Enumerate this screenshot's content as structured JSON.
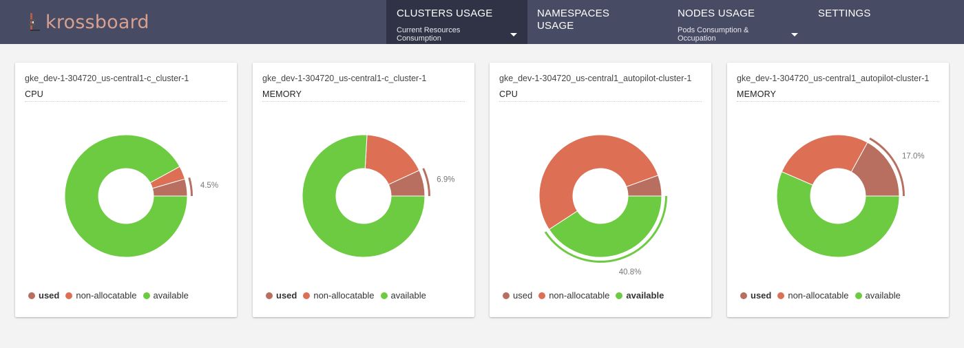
{
  "app": {
    "logo_text": "krossboard"
  },
  "nav": [
    {
      "label": "CLUSTERS USAGE",
      "sub": "Current Resources Consumption",
      "active": true
    },
    {
      "label": "NAMESPACES USAGE",
      "sub": "",
      "active": false
    },
    {
      "label": "NODES USAGE",
      "sub": "Pods Consumption & Occupation",
      "active": false
    },
    {
      "label": "SETTINGS",
      "sub": "",
      "active": false
    }
  ],
  "colors": {
    "used": "#b86f60",
    "non_allocatable": "#dd6f55",
    "available": "#6dcb42",
    "header_bg": "#474b63",
    "header_active_bg": "#2f3345"
  },
  "legend": {
    "used": "used",
    "non_allocatable": "non-allocatable",
    "available": "available"
  },
  "cards": [
    {
      "cluster": "gke_dev-1-304720_us-central1-c_cluster-1",
      "metric": "CPU",
      "highlight": "used",
      "highlight_label": "4.5%"
    },
    {
      "cluster": "gke_dev-1-304720_us-central1-c_cluster-1",
      "metric": "MEMORY",
      "highlight": "used",
      "highlight_label": "6.9%"
    },
    {
      "cluster": "gke_dev-1-304720_us-central1_autopilot-cluster-1",
      "metric": "CPU",
      "highlight": "available",
      "highlight_label": "40.8%"
    },
    {
      "cluster": "gke_dev-1-304720_us-central1_autopilot-cluster-1",
      "metric": "MEMORY",
      "highlight": "used",
      "highlight_label": "17.0%"
    }
  ],
  "chart_data": [
    {
      "type": "pie",
      "title": "CPU",
      "categories": [
        "used",
        "non-allocatable",
        "available"
      ],
      "values": [
        4.5,
        3.5,
        92.0
      ]
    },
    {
      "type": "pie",
      "title": "MEMORY",
      "categories": [
        "used",
        "non-allocatable",
        "available"
      ],
      "values": [
        6.9,
        17.2,
        75.9
      ]
    },
    {
      "type": "pie",
      "title": "CPU",
      "categories": [
        "used",
        "non-allocatable",
        "available"
      ],
      "values": [
        5.5,
        53.7,
        40.8
      ]
    },
    {
      "type": "pie",
      "title": "MEMORY",
      "categories": [
        "used",
        "non-allocatable",
        "available"
      ],
      "values": [
        17.0,
        26.5,
        56.5
      ]
    }
  ]
}
